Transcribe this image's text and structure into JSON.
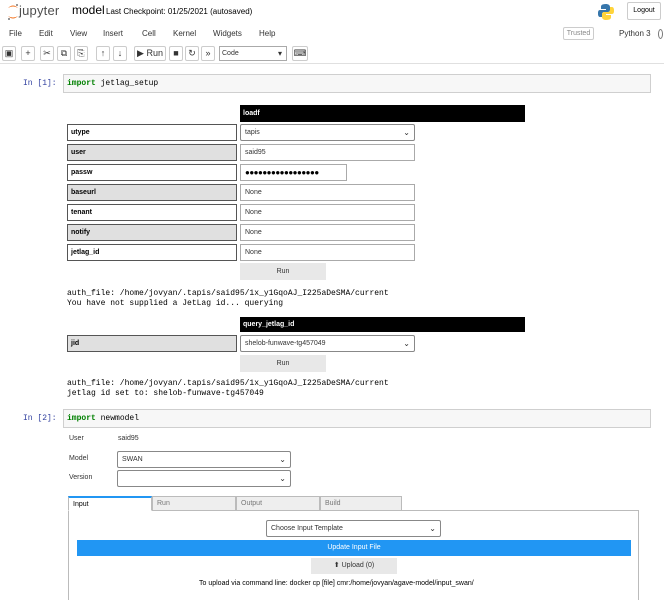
{
  "header": {
    "logo_text": "jupyter",
    "notebook_name": "model",
    "checkpoint": "Last Checkpoint: 01/25/2021  (autosaved)",
    "logout": "Logout",
    "trusted": "Trusted",
    "kernel": "Python 3"
  },
  "menu": [
    "File",
    "Edit",
    "View",
    "Insert",
    "Cell",
    "Kernel",
    "Widgets",
    "Help"
  ],
  "toolbar": {
    "run_label": "Run",
    "cell_type": "Code"
  },
  "cell1": {
    "prompt": "In [1]:",
    "keyword": "import",
    "module": "jetlag_setup",
    "form_header": "loadf",
    "fields": [
      {
        "label": "utype",
        "value": "tapis",
        "type": "select"
      },
      {
        "label": "user",
        "value": "said95",
        "type": "text"
      },
      {
        "label": "passw",
        "value": "●●●●●●●●●●●●●●●●●",
        "type": "password"
      },
      {
        "label": "baseurl",
        "value": "None",
        "type": "text"
      },
      {
        "label": "tenant",
        "value": "None",
        "type": "text"
      },
      {
        "label": "notify",
        "value": "None",
        "type": "text"
      },
      {
        "label": "jetlag_id",
        "value": "None",
        "type": "text"
      }
    ],
    "run_label": "Run",
    "output1_line1": "auth_file: /home/jovyan/.tapis/said95/1x_y1GqoAJ_I225aDeSMA/current",
    "output1_line2": "You have not supplied a JetLag id... querying",
    "query_header": "query_jetlag_id",
    "jid_label": "jid",
    "jid_value": "shelob-funwave-tg457049",
    "run2_label": "Run",
    "output2_line1": "auth_file: /home/jovyan/.tapis/said95/1x_y1GqoAJ_I225aDeSMA/current",
    "output2_line2": "jetlag id set to: shelob-funwave-tg457049"
  },
  "cell2": {
    "prompt": "In [2]:",
    "keyword": "import",
    "module": "newmodel",
    "user_label": "User",
    "user_value": "said95",
    "model_label": "Model",
    "model_value": "SWAN",
    "version_label": "Version",
    "version_value": "",
    "tabs": [
      "Input",
      "Run",
      "Output",
      "Build"
    ],
    "template_select": "Choose Input Template",
    "update_button": "Update Input File",
    "upload_button": "Upload (0)",
    "cmd_text": "To upload via command line: docker cp [file] cmr:/home/jovyan/agave-model/input_swan/"
  },
  "colors": {
    "prompt": "#303f9f",
    "keyword": "#008000",
    "accent": "#2196f3"
  }
}
